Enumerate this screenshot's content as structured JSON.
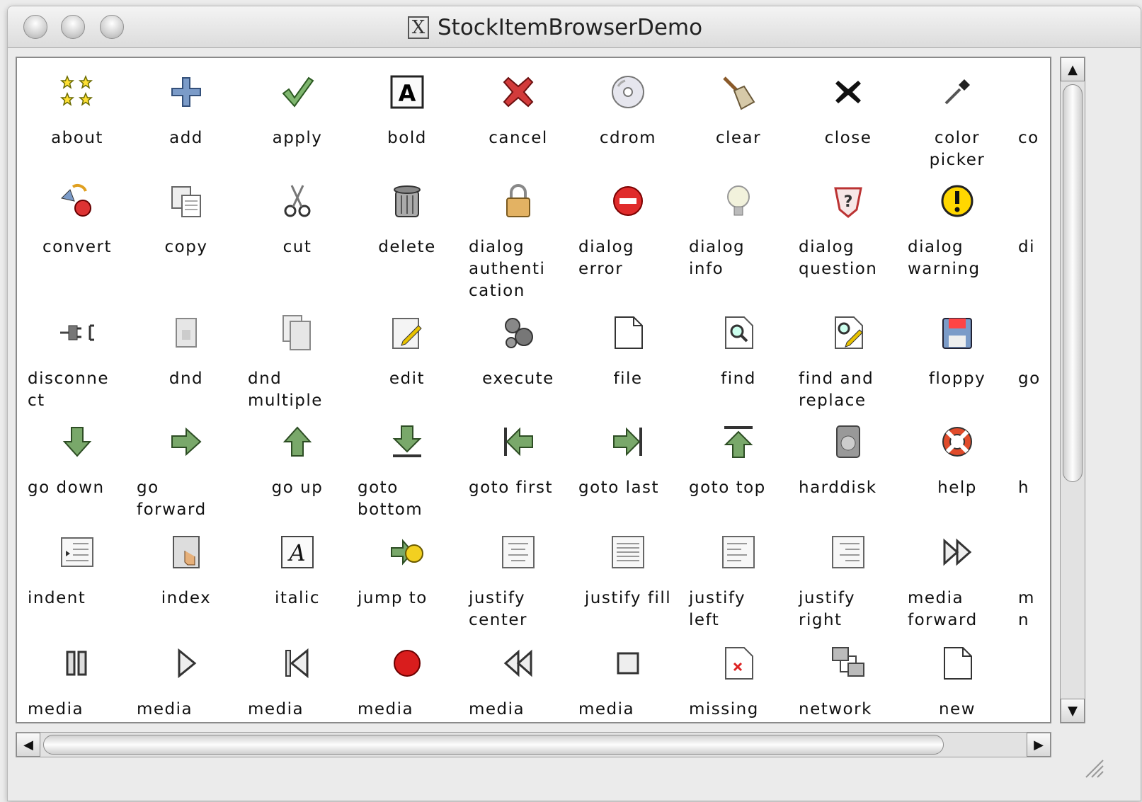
{
  "window": {
    "title": "StockItemBrowserDemo",
    "x_glyph": "X"
  },
  "items": [
    [
      "about",
      "add",
      "apply",
      "bold",
      "cancel",
      "cdrom",
      "clear",
      "close",
      "color\npicker",
      "co"
    ],
    [
      "convert",
      "copy",
      "cut",
      "delete",
      "dialog\nauthenti\ncation",
      "dialog\nerror",
      "dialog\ninfo",
      "dialog\nquestion",
      "dialog\nwarning",
      "di"
    ],
    [
      "disconne\nct",
      "dnd",
      "dnd\nmultiple",
      "edit",
      "execute",
      "file",
      "find",
      "find and\nreplace",
      "floppy",
      "go"
    ],
    [
      "go down",
      "go\nforward",
      "go up",
      "goto\nbottom",
      "goto first",
      "goto last",
      "goto top",
      "harddisk",
      "help",
      "h"
    ],
    [
      "indent",
      "index",
      "italic",
      "jump to",
      "justify\ncenter",
      "justify fill",
      "justify\nleft",
      "justify\nright",
      "media\nforward",
      "m\nn"
    ],
    [
      "media\npause",
      "media\nplay",
      "media\nprevious",
      "media\nrecord",
      "media\nrewind",
      "media\nstop",
      "missing\nimage",
      "network",
      "new",
      ""
    ]
  ],
  "icons": [
    [
      "stars-icon",
      "plus-icon",
      "checkmark-icon",
      "bold-a-icon",
      "red-x-icon",
      "cdrom-icon",
      "broom-icon",
      "black-x-icon",
      "eyedropper-icon",
      ""
    ],
    [
      "convert-icon",
      "copy-icon",
      "scissors-icon",
      "trash-icon",
      "padlock-icon",
      "error-icon",
      "bulb-icon",
      "question-icon",
      "warning-icon",
      ""
    ],
    [
      "plug-icon",
      "dnd-icon",
      "dnd-multiple-icon",
      "edit-icon",
      "gears-icon",
      "file-icon",
      "find-icon",
      "find-replace-icon",
      "floppy-icon",
      ""
    ],
    [
      "arrow-down-icon",
      "arrow-right-icon",
      "arrow-up-icon",
      "goto-bottom-icon",
      "goto-first-icon",
      "goto-last-icon",
      "goto-top-icon",
      "harddisk-icon",
      "lifebuoy-icon",
      ""
    ],
    [
      "indent-icon",
      "index-icon",
      "italic-icon",
      "jump-to-icon",
      "justify-center-icon",
      "justify-fill-icon",
      "justify-left-icon",
      "justify-right-icon",
      "forward-icon",
      ""
    ],
    [
      "pause-icon",
      "play-icon",
      "previous-icon",
      "record-icon",
      "rewind-icon",
      "stop-icon",
      "missing-image-icon",
      "network-icon",
      "new-icon",
      ""
    ]
  ],
  "scrollbars": {
    "up": "▲",
    "down": "▼",
    "left": "◀",
    "right": "▶"
  }
}
